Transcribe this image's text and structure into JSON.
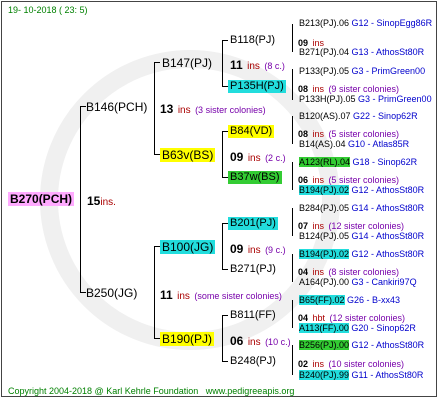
{
  "header": "19-  10-2018  ( 23:  5)",
  "footer": {
    "copyright": "Copyright 2004-2018 @ Karl Kehrle Foundation",
    "site": "www.pedigreeapis.org"
  },
  "root": {
    "label": "B270(PCH)",
    "ins": "15",
    "ins_word": "ins."
  },
  "gen1": [
    {
      "label": "B146(PCH)",
      "ins": "13",
      "ins_word": "ins",
      "sis": "(3 sister colonies)"
    },
    {
      "label": "B250(JG)",
      "ins": "11",
      "ins_word": "ins",
      "sis": "(some sister colonies)"
    }
  ],
  "gen2": [
    {
      "label": "B147(PJ)",
      "ins": "11",
      "ins_word": "ins",
      "sis": "(8 c.)"
    },
    {
      "label": "B63v(BS)",
      "ins": "09",
      "ins_word": "ins",
      "sis": "(2 c.)"
    },
    {
      "label": "B100(JG)",
      "ins": "09",
      "ins_word": "ins",
      "sis": "(9 c.)"
    },
    {
      "label": "B190(PJ)",
      "ins": "06",
      "ins_word": "ins",
      "sis": "(10 c.)"
    }
  ],
  "gen3": [
    {
      "label": "B118(PJ)",
      "ins": "09",
      "ins_word": "ins",
      "sis": ""
    },
    {
      "label": "P135H(PJ)",
      "ins": "08",
      "ins_word": "ins",
      "sis": "(9 sister colonies)"
    },
    {
      "label": "B84(VD)",
      "ins": "08",
      "ins_word": "ins",
      "sis": "(5 sister colonies)"
    },
    {
      "label": "B37w(BS)",
      "ins": "06",
      "ins_word": "ins",
      "sis": "(5 sister colonies)"
    },
    {
      "label": "B201(PJ)",
      "ins": "07",
      "ins_word": "ins",
      "sis": "(12 sister colonies)"
    },
    {
      "label": "B271(PJ)",
      "ins": "04",
      "ins_word": "ins",
      "sis": "(8 sister colonies)"
    },
    {
      "label": "B811(FF)",
      "ins": "04",
      "ins_word": "hbt",
      "sis": "(12 sister colonies)"
    },
    {
      "label": "B248(PJ)",
      "ins": "02",
      "ins_word": "ins",
      "sis": "(10 sister colonies)"
    }
  ],
  "gen4": [
    {
      "name": "B213(PJ).06",
      "code": "G12 - SinopEgg86R"
    },
    {
      "name": "B271(PJ).04",
      "code": "G13 - AthosSt80R"
    },
    {
      "name": "P133(PJ).05",
      "code": "G3 - PrimGreen00"
    },
    {
      "name": "P133H(PJ).05",
      "code": "G3 - PrimGreen00"
    },
    {
      "name": "B120(AS).07",
      "code": "G22 - Sinop62R"
    },
    {
      "name": "B14(AS).04",
      "code": "G10 - Atlas85R"
    },
    {
      "name": "A123(RL).04",
      "code": "G18 - Sinop62R"
    },
    {
      "name": "B194(PJ).02",
      "code": "G12 - AthosSt80R"
    },
    {
      "name": "B284(PJ).05",
      "code": "G14 - AthosSt80R"
    },
    {
      "name": "B124(PJ).05",
      "code": "G14 - AthosSt80R"
    },
    {
      "name": "B194(PJ).02",
      "code": "G12 - AthosSt80R"
    },
    {
      "name": "A164(PJ).00",
      "code": "G3 - Cankiri97Q"
    },
    {
      "name": "B65(FF).02",
      "code": "G26 - B-xx43"
    },
    {
      "name": "A113(FF).00",
      "code": "G20 - Sinop62R"
    },
    {
      "name": "B256(PJ).00",
      "code": "G12 - AthosSt80R"
    },
    {
      "name": "B240(PJ).99",
      "code": "G11 - AthosSt80R"
    }
  ]
}
